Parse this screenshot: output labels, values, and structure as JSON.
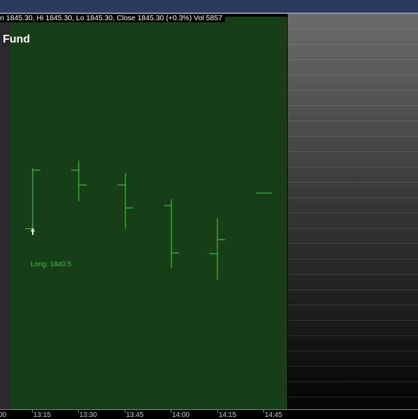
{
  "info_bar": "n 1845.30, Hi 1845.30, Lo 1845.30, Close 1845.30 (+0.3%) Vol 5857",
  "chart_title": "Fund",
  "colors": {
    "plot_bg": "#173f17",
    "bar": "#3fbf3f",
    "annotation": "#3fbf3f"
  },
  "annotation": "Long: 1840.5",
  "chart_data": {
    "type": "ohlc",
    "title": "Fund",
    "x": [
      "13:15",
      "13:30",
      "13:45",
      "14:00",
      "14:15",
      "14:45"
    ],
    "open": [
      1840.5,
      1848.4,
      1846.4,
      1843.6,
      1837.1,
      1845.3
    ],
    "high": [
      1848.7,
      1849.7,
      1848.0,
      1844.5,
      1841.9,
      1845.3
    ],
    "low": [
      1840.4,
      1844.2,
      1840.5,
      1835.2,
      1833.6,
      1845.3
    ],
    "close": [
      1848.4,
      1846.4,
      1843.3,
      1837.2,
      1839.0,
      1845.3
    ],
    "marker": {
      "label": "Long: 1840.5",
      "price": 1840.5,
      "bar": 0
    }
  },
  "x_axis": {
    "labels": [
      "00",
      "13:15",
      "13:30",
      "13:45",
      "14:00",
      "14:15",
      "14:45"
    ]
  }
}
